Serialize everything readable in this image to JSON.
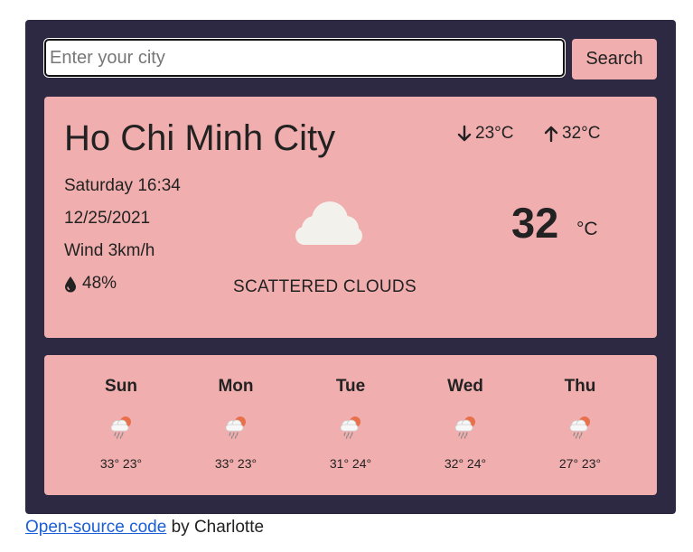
{
  "search": {
    "placeholder": "Enter your city",
    "button_label": "Search"
  },
  "current": {
    "city": "Ho Chi Minh City",
    "min_temp": "23°C",
    "max_temp": "32°C",
    "day_time": "Saturday 16:34",
    "date": "12/25/2021",
    "wind": "Wind 3km/h",
    "humidity": "48%",
    "description": "SCATTERED CLOUDS",
    "temperature": "32",
    "unit": "°C",
    "icon": "cloud-icon"
  },
  "forecast": [
    {
      "day": "Sun",
      "temps": "33° 23°",
      "icon": "rain-sun-icon"
    },
    {
      "day": "Mon",
      "temps": "33° 23°",
      "icon": "rain-sun-icon"
    },
    {
      "day": "Tue",
      "temps": "31° 24°",
      "icon": "rain-sun-icon"
    },
    {
      "day": "Wed",
      "temps": "32° 24°",
      "icon": "rain-sun-icon"
    },
    {
      "day": "Thu",
      "temps": "27° 23°",
      "icon": "rain-sun-icon"
    }
  ],
  "footer": {
    "link_text": "Open-source code",
    "suffix": " by Charlotte"
  },
  "colors": {
    "background": "#2d2942",
    "card": "#f1aeae",
    "link": "#1a5fd6"
  }
}
